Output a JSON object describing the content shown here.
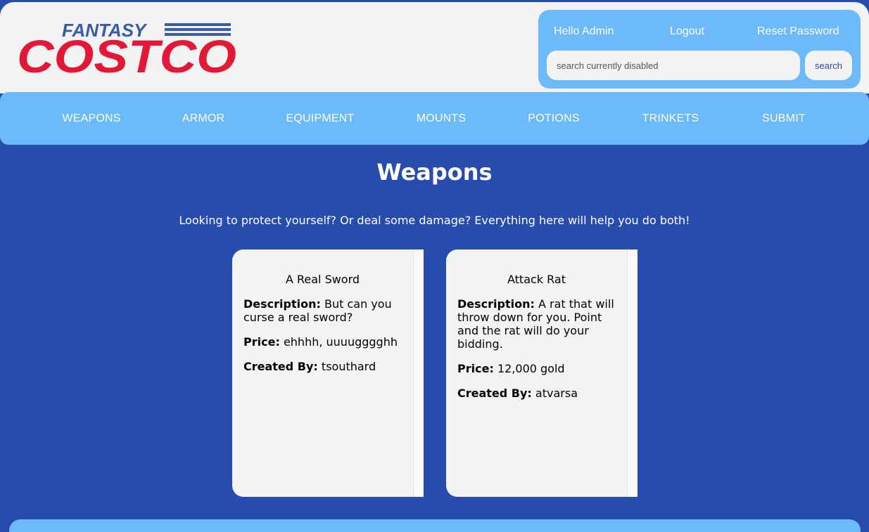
{
  "header": {
    "logo_text_top": "FANTASY",
    "logo_text_main": "COSTCO",
    "greeting": "Hello Admin",
    "logout_label": "Logout",
    "reset_password_label": "Reset Password",
    "search_placeholder": "search currently disabled",
    "search_button_label": "search"
  },
  "nav": {
    "items": [
      {
        "label": "WEAPONS"
      },
      {
        "label": "ARMOR"
      },
      {
        "label": "EQUIPMENT"
      },
      {
        "label": "MOUNTS"
      },
      {
        "label": "POTIONS"
      },
      {
        "label": "TRINKETS"
      },
      {
        "label": "SUBMIT"
      }
    ]
  },
  "main": {
    "title": "Weapons",
    "subtitle": "Looking to protect yourself? Or deal some damage? Everything here will help you do both!",
    "cards": [
      {
        "title": "A Real Sword",
        "description_label": "Description:",
        "description": "But can you curse a real sword?",
        "price_label": "Price:",
        "price": "ehhhh, uuuugggghh",
        "created_by_label": "Created By:",
        "created_by": "tsouthard"
      },
      {
        "title": "Attack Rat",
        "description_label": "Description:",
        "description": "A rat that will throw down for you. Point and the rat will do your bidding.",
        "price_label": "Price:",
        "price": "12,000 gold",
        "created_by_label": "Created By:",
        "created_by": "atvarsa"
      }
    ]
  },
  "colors": {
    "background": "#274cab",
    "accent_light": "#6cbafb",
    "panel": "#f3f3f3",
    "logo_red": "#e31837",
    "logo_blue": "#3a5ba8"
  }
}
